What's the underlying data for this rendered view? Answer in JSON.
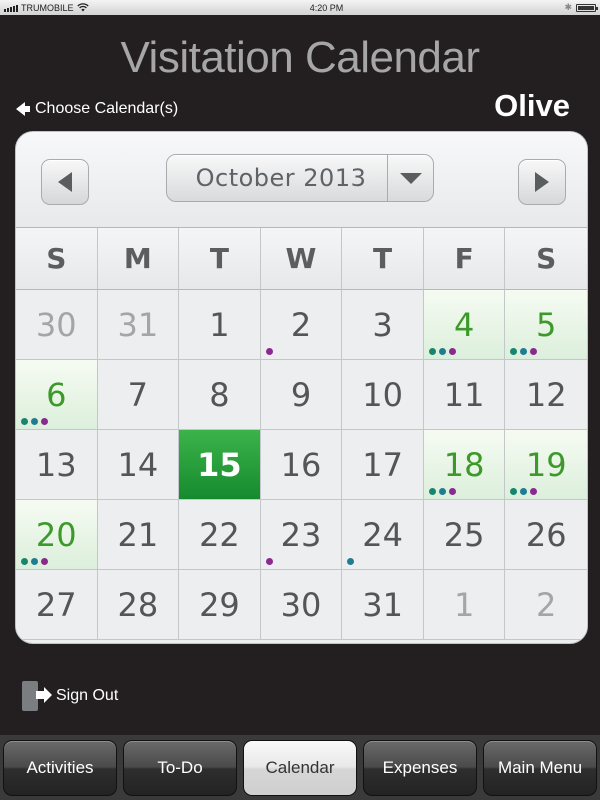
{
  "statusbar": {
    "carrier": "TRUMOBILE",
    "time": "4:20 PM",
    "bluetooth": "✱"
  },
  "title": "Visitation Calendar",
  "choose_calendars": "Choose Calendar(s)",
  "child_name": "Olive",
  "calendar": {
    "month_label": "October 2013",
    "weekdays": [
      "S",
      "M",
      "T",
      "W",
      "T",
      "F",
      "S"
    ],
    "days": [
      {
        "n": "30",
        "other": true,
        "visit": false,
        "today": false,
        "dots": []
      },
      {
        "n": "31",
        "other": true,
        "visit": false,
        "today": false,
        "dots": []
      },
      {
        "n": "1",
        "other": false,
        "visit": false,
        "today": false,
        "dots": []
      },
      {
        "n": "2",
        "other": false,
        "visit": false,
        "today": false,
        "dots": [
          "purple"
        ]
      },
      {
        "n": "3",
        "other": false,
        "visit": false,
        "today": false,
        "dots": []
      },
      {
        "n": "4",
        "other": false,
        "visit": true,
        "today": false,
        "dots": [
          "green",
          "teal",
          "purple"
        ]
      },
      {
        "n": "5",
        "other": false,
        "visit": true,
        "today": false,
        "dots": [
          "green",
          "teal",
          "purple"
        ]
      },
      {
        "n": "6",
        "other": false,
        "visit": true,
        "today": false,
        "dots": [
          "green",
          "teal",
          "purple"
        ]
      },
      {
        "n": "7",
        "other": false,
        "visit": false,
        "today": false,
        "dots": []
      },
      {
        "n": "8",
        "other": false,
        "visit": false,
        "today": false,
        "dots": []
      },
      {
        "n": "9",
        "other": false,
        "visit": false,
        "today": false,
        "dots": []
      },
      {
        "n": "10",
        "other": false,
        "visit": false,
        "today": false,
        "dots": []
      },
      {
        "n": "11",
        "other": false,
        "visit": false,
        "today": false,
        "dots": []
      },
      {
        "n": "12",
        "other": false,
        "visit": false,
        "today": false,
        "dots": []
      },
      {
        "n": "13",
        "other": false,
        "visit": false,
        "today": false,
        "dots": []
      },
      {
        "n": "14",
        "other": false,
        "visit": false,
        "today": false,
        "dots": []
      },
      {
        "n": "15",
        "other": false,
        "visit": false,
        "today": true,
        "dots": []
      },
      {
        "n": "16",
        "other": false,
        "visit": false,
        "today": false,
        "dots": []
      },
      {
        "n": "17",
        "other": false,
        "visit": false,
        "today": false,
        "dots": []
      },
      {
        "n": "18",
        "other": false,
        "visit": true,
        "today": false,
        "dots": [
          "green",
          "teal",
          "purple"
        ]
      },
      {
        "n": "19",
        "other": false,
        "visit": true,
        "today": false,
        "dots": [
          "green",
          "teal",
          "purple"
        ]
      },
      {
        "n": "20",
        "other": false,
        "visit": true,
        "today": false,
        "dots": [
          "green",
          "teal",
          "purple"
        ]
      },
      {
        "n": "21",
        "other": false,
        "visit": false,
        "today": false,
        "dots": []
      },
      {
        "n": "22",
        "other": false,
        "visit": false,
        "today": false,
        "dots": []
      },
      {
        "n": "23",
        "other": false,
        "visit": false,
        "today": false,
        "dots": [
          "purple"
        ]
      },
      {
        "n": "24",
        "other": false,
        "visit": false,
        "today": false,
        "dots": [
          "teal"
        ]
      },
      {
        "n": "25",
        "other": false,
        "visit": false,
        "today": false,
        "dots": []
      },
      {
        "n": "26",
        "other": false,
        "visit": false,
        "today": false,
        "dots": []
      },
      {
        "n": "27",
        "other": false,
        "visit": false,
        "today": false,
        "dots": []
      },
      {
        "n": "28",
        "other": false,
        "visit": false,
        "today": false,
        "dots": []
      },
      {
        "n": "29",
        "other": false,
        "visit": false,
        "today": false,
        "dots": []
      },
      {
        "n": "30",
        "other": false,
        "visit": false,
        "today": false,
        "dots": []
      },
      {
        "n": "31",
        "other": false,
        "visit": false,
        "today": false,
        "dots": []
      },
      {
        "n": "1",
        "other": true,
        "visit": false,
        "today": false,
        "dots": []
      },
      {
        "n": "2",
        "other": true,
        "visit": false,
        "today": false,
        "dots": []
      }
    ]
  },
  "colors": {
    "visit_text": "#3d9a2a",
    "today_bg": "#1f9b3a",
    "dot_green": "#18866d",
    "dot_teal": "#1f7d91",
    "dot_purple": "#8a2a8e"
  },
  "sign_out": "Sign Out",
  "tabs": [
    {
      "label": "Activities",
      "active": false
    },
    {
      "label": "To-Do",
      "active": false
    },
    {
      "label": "Calendar",
      "active": true
    },
    {
      "label": "Expenses",
      "active": false
    },
    {
      "label": "Main Menu",
      "active": false
    }
  ]
}
